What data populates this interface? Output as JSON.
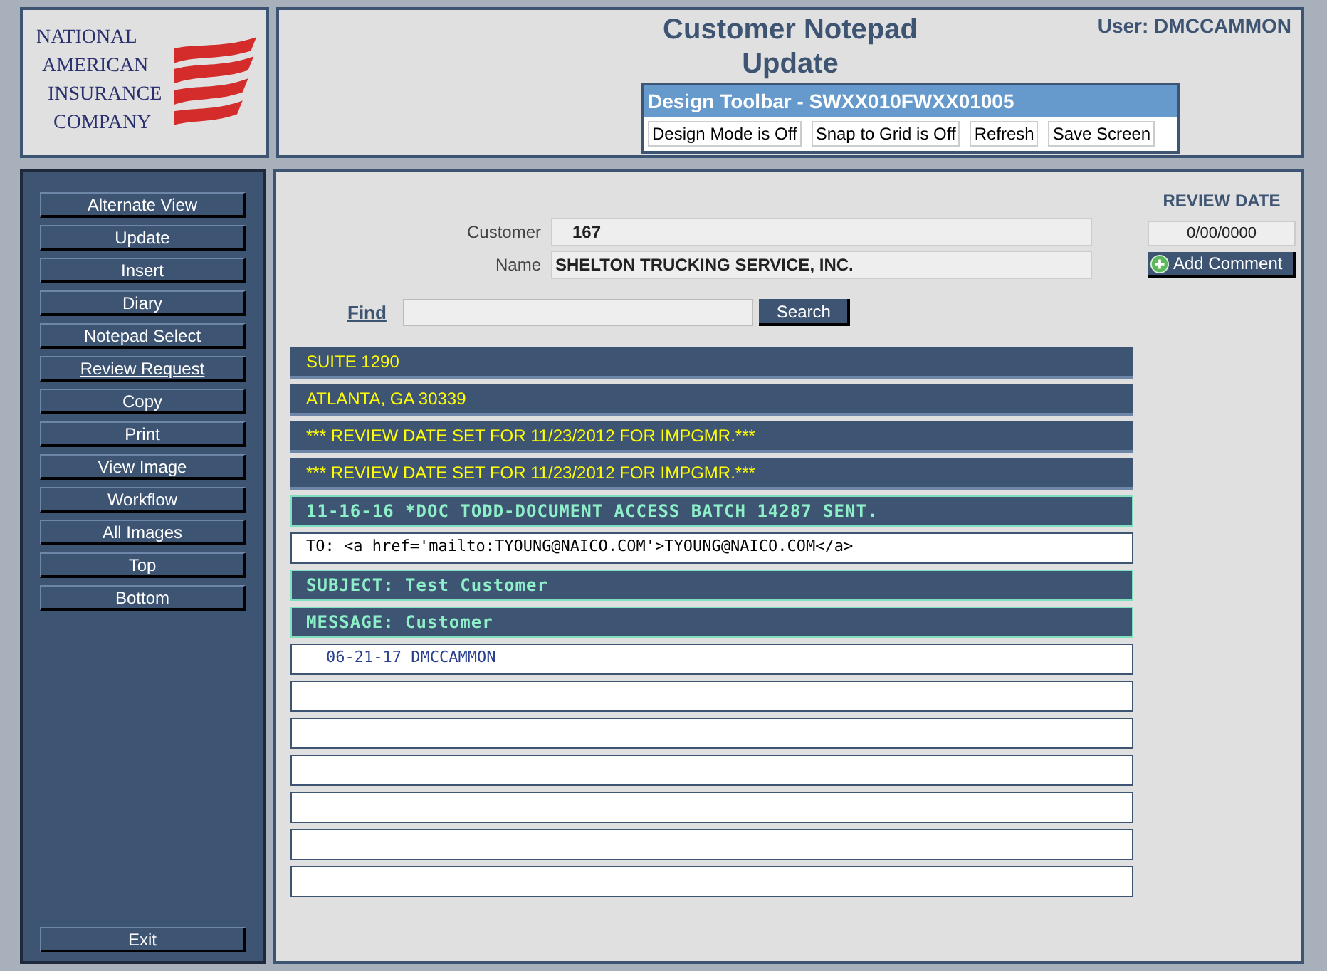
{
  "logo": {
    "lines": [
      "NATIONAL",
      "AMERICAN",
      "INSURANCE",
      "COMPANY"
    ]
  },
  "header": {
    "title": "Customer Notepad",
    "subtitle": "Update",
    "user": "User: DMCCAMMON"
  },
  "design_toolbar": {
    "title": "Design Toolbar - SWXX010FWXX01005",
    "buttons": [
      "Design Mode is Off",
      "Snap to Grid is Off",
      "Refresh",
      "Save Screen"
    ]
  },
  "sidebar": {
    "items": [
      {
        "label": "Alternate View",
        "underline": false
      },
      {
        "label": "Update",
        "underline": false
      },
      {
        "label": "Insert",
        "underline": false
      },
      {
        "label": "Diary",
        "underline": false
      },
      {
        "label": "Notepad Select",
        "underline": false
      },
      {
        "label": "Review Request",
        "underline": true
      },
      {
        "label": "Copy",
        "underline": false
      },
      {
        "label": "Print",
        "underline": false
      },
      {
        "label": "View Image",
        "underline": false
      },
      {
        "label": "Workflow",
        "underline": false
      },
      {
        "label": "All Images",
        "underline": false
      },
      {
        "label": "Top",
        "underline": false
      },
      {
        "label": "Bottom",
        "underline": false
      }
    ],
    "exit": "Exit"
  },
  "form": {
    "fields": [
      {
        "label": "Customer",
        "value": "167"
      },
      {
        "label": "Name",
        "value": "SHELTON TRUCKING SERVICE, INC."
      }
    ],
    "find_link": "Find",
    "search_button": "Search"
  },
  "review": {
    "label": "REVIEW DATE",
    "value": "0/00/0000",
    "add_comment": "Add Comment"
  },
  "notes": [
    {
      "kind": "highlight",
      "text": "SUITE 1290"
    },
    {
      "kind": "highlight",
      "text": "ATLANTA, GA  30339"
    },
    {
      "kind": "highlight",
      "text": "*** REVIEW DATE SET FOR 11/23/2012 FOR IMPGMR.***"
    },
    {
      "kind": "highlight",
      "text": "*** REVIEW DATE SET FOR 11/23/2012 FOR IMPGMR.***"
    },
    {
      "kind": "code",
      "text": "11-16-16 *DOC TODD-DOCUMENT ACCESS BATCH 14287 SENT."
    },
    {
      "kind": "plain",
      "text": "TO: <a href='mailto:TYOUNG@NAICO.COM'>TYOUNG@NAICO.COM</a>"
    },
    {
      "kind": "code",
      "text": "SUBJECT: Test Customer"
    },
    {
      "kind": "code",
      "text": "MESSAGE: Customer"
    },
    {
      "kind": "entry",
      "text": "06-21-17 DMCCAMMON"
    },
    {
      "kind": "blank"
    },
    {
      "kind": "blank"
    },
    {
      "kind": "blank"
    },
    {
      "kind": "blank"
    },
    {
      "kind": "blank"
    },
    {
      "kind": "blank"
    }
  ]
}
